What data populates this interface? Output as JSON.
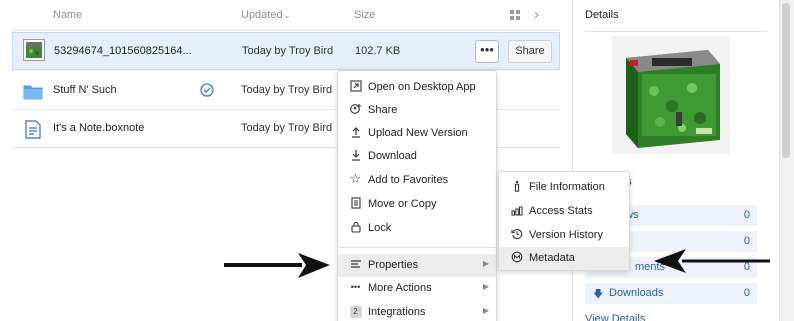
{
  "list": {
    "headers": {
      "name": "Name",
      "updated": "Updated",
      "size": "Size"
    },
    "rows": [
      {
        "name": "53294674_101560825164...",
        "updated": "Today by Troy Bird",
        "size": "102.7 KB",
        "more_label": "•••",
        "share_label": "Share"
      },
      {
        "name": "Stuff N' Such",
        "updated": "Today by Troy Bird",
        "size": ""
      },
      {
        "name": "It's a Note.boxnote",
        "updated": "Today by Troy Bird",
        "size": ""
      }
    ]
  },
  "context_menu": {
    "items": [
      {
        "label": "Open on Desktop App",
        "icon": "open-desktop-icon"
      },
      {
        "label": "Share",
        "icon": "share-icon"
      },
      {
        "label": "Upload New Version",
        "icon": "upload-icon"
      },
      {
        "label": "Download",
        "icon": "download-icon"
      },
      {
        "label": "Add to Favorites",
        "icon": "star-icon"
      },
      {
        "label": "Move or Copy",
        "icon": "copy-icon"
      },
      {
        "label": "Lock",
        "icon": "lock-icon"
      },
      {
        "label": "Properties",
        "icon": "properties-icon"
      },
      {
        "label": "More Actions",
        "icon": "more-icon"
      },
      {
        "label": "Integrations",
        "icon": "integrations-badge",
        "badge": "2"
      }
    ]
  },
  "submenu": {
    "items": [
      {
        "label": "File Information",
        "icon": "info-icon"
      },
      {
        "label": "Access Stats",
        "icon": "stats-icon"
      },
      {
        "label": "Version History",
        "icon": "history-icon"
      },
      {
        "label": "Metadata",
        "icon": "metadata-icon"
      }
    ]
  },
  "details": {
    "title": "Details",
    "stats_title_partial": "nts",
    "stats": [
      {
        "label": "ews",
        "value": "0"
      },
      {
        "label": "",
        "value": "0"
      },
      {
        "label": "ments",
        "value": "0"
      },
      {
        "label": "Downloads",
        "value": "0"
      }
    ],
    "view_details": "View Details"
  },
  "colors": {
    "accent": "#2a5db0",
    "selected_row": "#e6eefb",
    "menu_highlight": "#ececec"
  }
}
